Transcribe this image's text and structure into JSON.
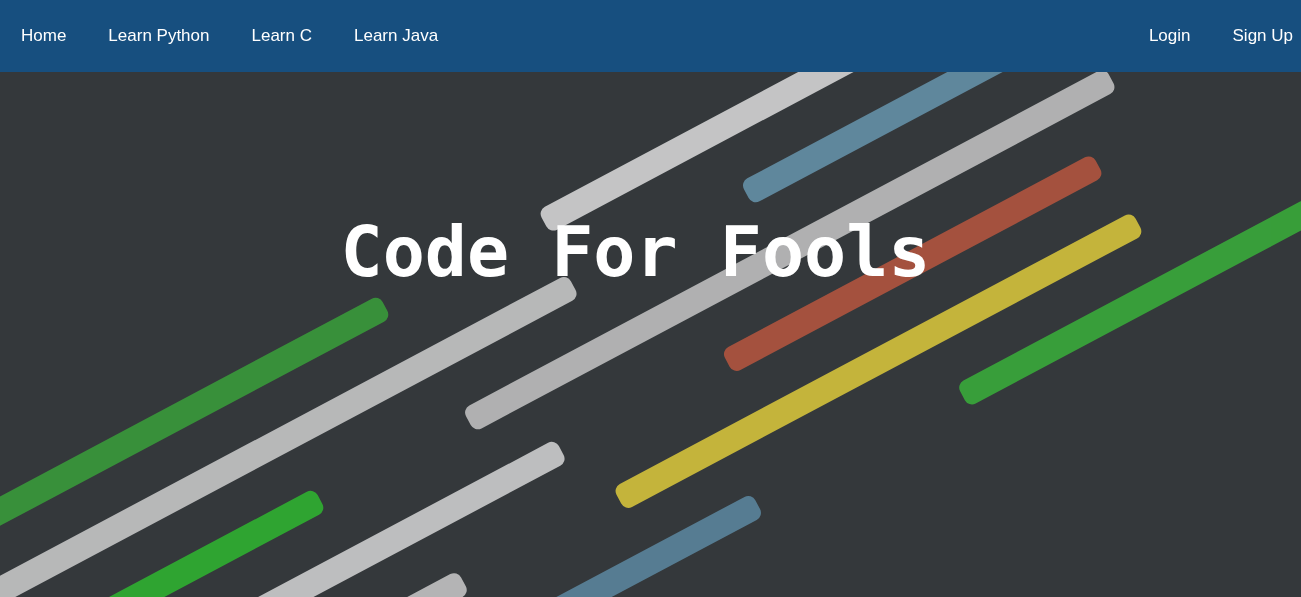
{
  "nav": {
    "left": [
      {
        "label": "Home"
      },
      {
        "label": "Learn Python"
      },
      {
        "label": "Learn C"
      },
      {
        "label": "Learn Java"
      }
    ],
    "right": [
      {
        "label": "Login"
      },
      {
        "label": "Sign Up"
      }
    ]
  },
  "hero": {
    "kind": "picture",
    "title": "Code For Fools"
  }
}
